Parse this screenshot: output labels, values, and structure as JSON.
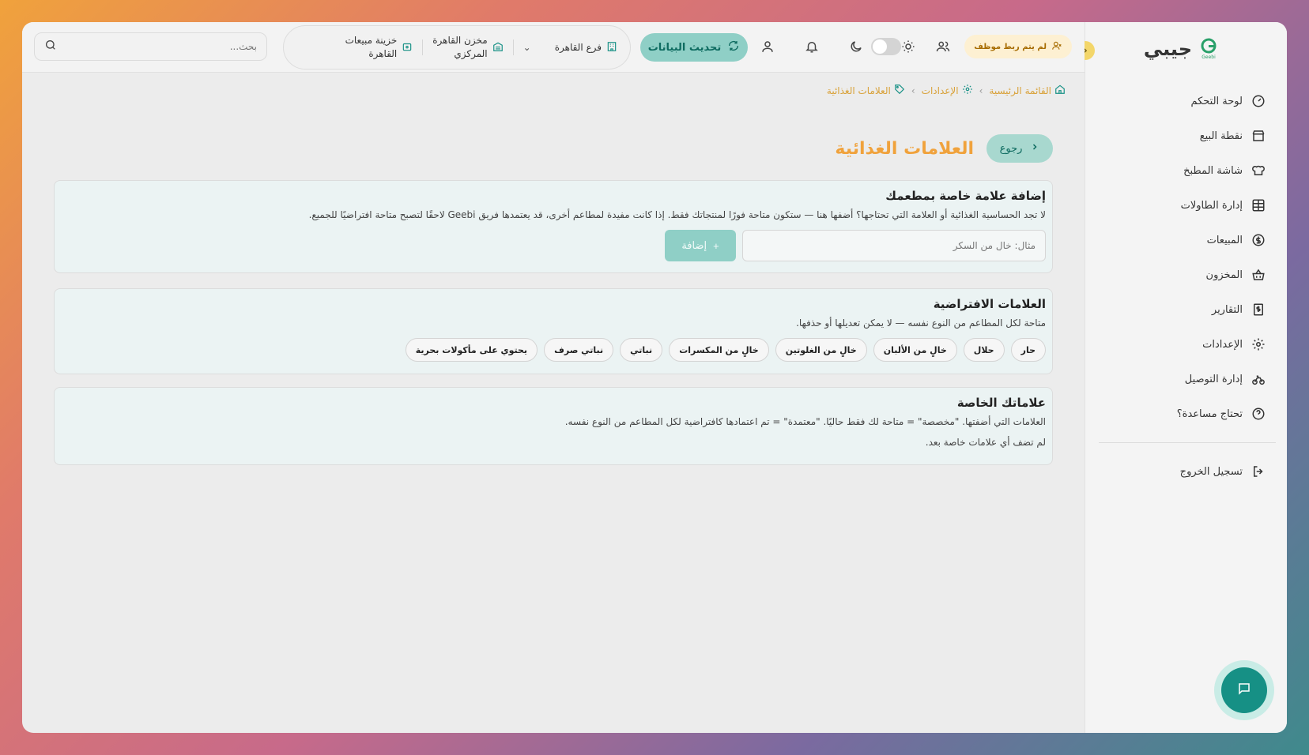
{
  "app": {
    "logo_text": "جيبي",
    "logo_small": "Geebi"
  },
  "sidebar": {
    "items": [
      {
        "label": "لوحة التحكم",
        "icon": "gauge-icon"
      },
      {
        "label": "نقطة البيع",
        "icon": "store-icon"
      },
      {
        "label": "شاشة المطبخ",
        "icon": "chef-hat-icon"
      },
      {
        "label": "إدارة الطاولات",
        "icon": "table-grid-icon"
      },
      {
        "label": "المبيعات",
        "icon": "dollar-circle-icon"
      },
      {
        "label": "المخزون",
        "icon": "basket-icon"
      },
      {
        "label": "التقارير",
        "icon": "report-dollar-icon"
      },
      {
        "label": "الإعدادات",
        "icon": "gear-icon"
      },
      {
        "label": "إدارة التوصيل",
        "icon": "bike-icon"
      },
      {
        "label": "تحتاج مساعدة؟",
        "icon": "help-circle-icon"
      }
    ],
    "logout": "تسجيل الخروج"
  },
  "topbar": {
    "unlinked_badge": "لم يتم ربط موظف",
    "refresh_label": "تحديث البيانات",
    "branch": "فرع القاهرة",
    "warehouse_line1": "مخزن القاهرة",
    "warehouse_line2": "المركزي",
    "treasury_line1": "خزينة مبيعات",
    "treasury_line2": "القاهرة",
    "search_placeholder": "بحث..."
  },
  "breadcrumb": {
    "home": "القائمة الرئيسية",
    "settings": "الإعدادات",
    "current": "العلامات الغذائية"
  },
  "page": {
    "back_label": "رجوع",
    "title": "العلامات الغذائية"
  },
  "add_card": {
    "title": "إضافة علامة خاصة بمطعمك",
    "description": "لا تجد الحساسية الغذائية أو العلامة التي تحتاجها؟ أضفها هنا — ستكون متاحة فورًا لمنتجاتك فقط. إذا كانت مفيدة لمطاعم أخرى، قد يعتمدها فريق Geebi لاحقًا لتصبح متاحة افتراضيًا للجميع.",
    "input_placeholder": "مثال: خالٍ من السكر",
    "add_label": "إضافة"
  },
  "default_card": {
    "title": "العلامات الافتراضية",
    "description": "متاحة لكل المطاعم من النوع نفسه — لا يمكن تعديلها أو حذفها.",
    "tags": [
      "حار",
      "حلال",
      "خالٍ من الألبان",
      "خالٍ من الغلوتين",
      "خالٍ من المكسرات",
      "نباتي",
      "نباتي صرف",
      "يحتوي على مأكولات بحرية"
    ]
  },
  "custom_card": {
    "title": "علاماتك الخاصة",
    "description": "العلامات التي أضفتها. \"مخصصة\" = متاحة لك فقط حاليًا. \"معتمدة\" = تم اعتمادها كافتراضية لكل المطاعم من النوع نفسه.",
    "empty": "لم تضف أي علامات خاصة بعد."
  },
  "colors": {
    "accent_teal": "#169085",
    "accent_orange": "#f0a23c"
  }
}
